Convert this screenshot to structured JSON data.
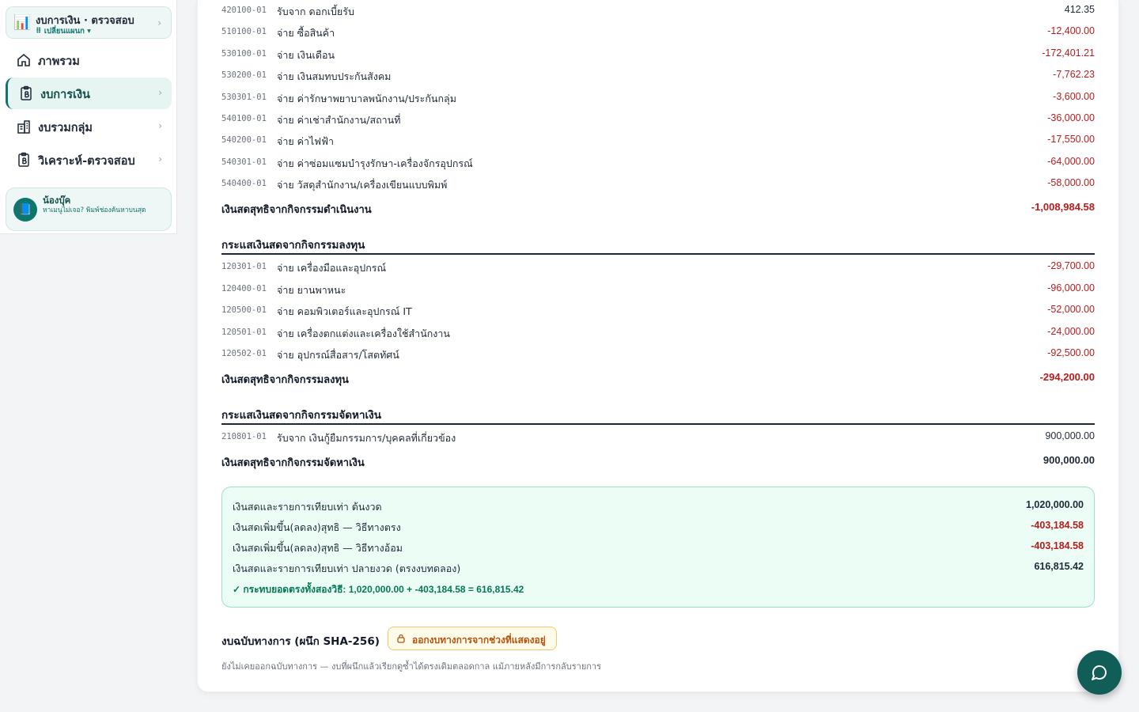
{
  "sidebar": {
    "header": {
      "title": "งบการเงิน · ตรวจสอบ",
      "subtitle": "⠿ เปลี่ยนแผนก ▾",
      "icon": "chart-icon"
    },
    "items": [
      {
        "label": "ภาพรวม",
        "icon": "home-icon",
        "active": false,
        "chevron": false
      },
      {
        "label": "งบการเงิน",
        "icon": "document-baht-icon",
        "active": true,
        "chevron": true
      },
      {
        "label": "งบรวมกลุ่ม",
        "icon": "building-icon",
        "active": false,
        "chevron": true
      },
      {
        "label": "วิเคราะห์-ตรวจสอบ",
        "icon": "document-baht-icon",
        "active": false,
        "chevron": true
      }
    ],
    "assistant": {
      "name": "น้องบุ๊ค",
      "hint": "หาเมนูไม่เจอ? พิมพ์ช่องค้นหาบนสุด",
      "icon": "book-icon"
    }
  },
  "operating": {
    "rows": [
      {
        "code": "420100-01",
        "desc": "รับจาก ดอกเบี้ยรับ",
        "amount": "412.35",
        "neg": false
      },
      {
        "code": "510100-01",
        "desc": "จ่าย ซื้อสินค้า",
        "amount": "-12,400.00",
        "neg": true
      },
      {
        "code": "530100-01",
        "desc": "จ่าย เงินเดือน",
        "amount": "-172,401.21",
        "neg": true
      },
      {
        "code": "530200-01",
        "desc": "จ่าย เงินสมทบประกันสังคม",
        "amount": "-7,762.23",
        "neg": true
      },
      {
        "code": "530301-01",
        "desc": "จ่าย ค่ารักษาพยาบาลพนักงาน/ประกันกลุ่ม",
        "amount": "-3,600.00",
        "neg": true
      },
      {
        "code": "540100-01",
        "desc": "จ่าย ค่าเช่าสำนักงาน/สถานที่",
        "amount": "-36,000.00",
        "neg": true
      },
      {
        "code": "540200-01",
        "desc": "จ่าย ค่าไฟฟ้า",
        "amount": "-17,550.00",
        "neg": true
      },
      {
        "code": "540301-01",
        "desc": "จ่าย ค่าซ่อมแซมบำรุงรักษา-เครื่องจักรอุปกรณ์",
        "amount": "-64,000.00",
        "neg": true
      },
      {
        "code": "540400-01",
        "desc": "จ่าย วัสดุสำนักงาน/เครื่องเขียนแบบพิมพ์",
        "amount": "-58,000.00",
        "neg": true
      }
    ],
    "subtotal_label": "เงินสดสุทธิจากกิจกรรมดำเนินงาน",
    "subtotal_amount": "-1,008,984.58"
  },
  "investing": {
    "title": "กระแสเงินสดจากกิจกรรมลงทุน",
    "rows": [
      {
        "code": "120301-01",
        "desc": "จ่าย เครื่องมือและอุปกรณ์",
        "amount": "-29,700.00",
        "neg": true
      },
      {
        "code": "120400-01",
        "desc": "จ่าย ยานพาหนะ",
        "amount": "-96,000.00",
        "neg": true
      },
      {
        "code": "120500-01",
        "desc": "จ่าย คอมพิวเตอร์และอุปกรณ์ IT",
        "amount": "-52,000.00",
        "neg": true
      },
      {
        "code": "120501-01",
        "desc": "จ่าย เครื่องตกแต่งและเครื่องใช้สำนักงาน",
        "amount": "-24,000.00",
        "neg": true
      },
      {
        "code": "120502-01",
        "desc": "จ่าย อุปกรณ์สื่อสาร/โสตทัศน์",
        "amount": "-92,500.00",
        "neg": true
      }
    ],
    "subtotal_label": "เงินสดสุทธิจากกิจกรรมลงทุน",
    "subtotal_amount": "-294,200.00"
  },
  "financing": {
    "title": "กระแสเงินสดจากกิจกรรมจัดหาเงิน",
    "rows": [
      {
        "code": "210801-01",
        "desc": "รับจาก เงินกู้ยืมกรรมการ/บุคคลที่เกี่ยวข้อง",
        "amount": "900,000.00",
        "neg": false
      }
    ],
    "subtotal_label": "เงินสดสุทธิจากกิจกรรมจัดหาเงิน",
    "subtotal_amount": "900,000.00"
  },
  "summary": {
    "rows": [
      {
        "label": "เงินสดและรายการเทียบเท่า ต้นงวด",
        "amount": "1,020,000.00",
        "neg": false
      },
      {
        "label": "เงินสดเพิ่มขึ้น(ลดลง)สุทธิ — วิธีทางตรง",
        "amount": "-403,184.58",
        "neg": true
      },
      {
        "label": "เงินสดเพิ่มขึ้น(ลดลง)สุทธิ — วิธีทางอ้อม",
        "amount": "-403,184.58",
        "neg": true
      },
      {
        "label": "เงินสดและรายการเทียบเท่า ปลายงวด (ตรงงบทดลอง)",
        "amount": "616,815.42",
        "neg": false
      }
    ],
    "check": "✓ กระทบยอดตรงทั้งสองวิธี: 1,020,000.00 + -403,184.58 = 616,815.42"
  },
  "official": {
    "title": "งบฉบับทางการ (ผนึก SHA-256)",
    "button_label": "ออกงบทางการจากช่วงที่แสดงอยู่",
    "note": "ยังไม่เคยออกฉบับทางการ — งบที่ผนึกแล้วเรียกดูซ้ำได้ตรงเดิมตลอดกาล แม้ภายหลังมีการกลับรายการ"
  },
  "colors": {
    "accent": "#0f766e",
    "negative": "#b91c1c",
    "summary_bg": "#ecfdf5",
    "warn": "#b45309"
  }
}
